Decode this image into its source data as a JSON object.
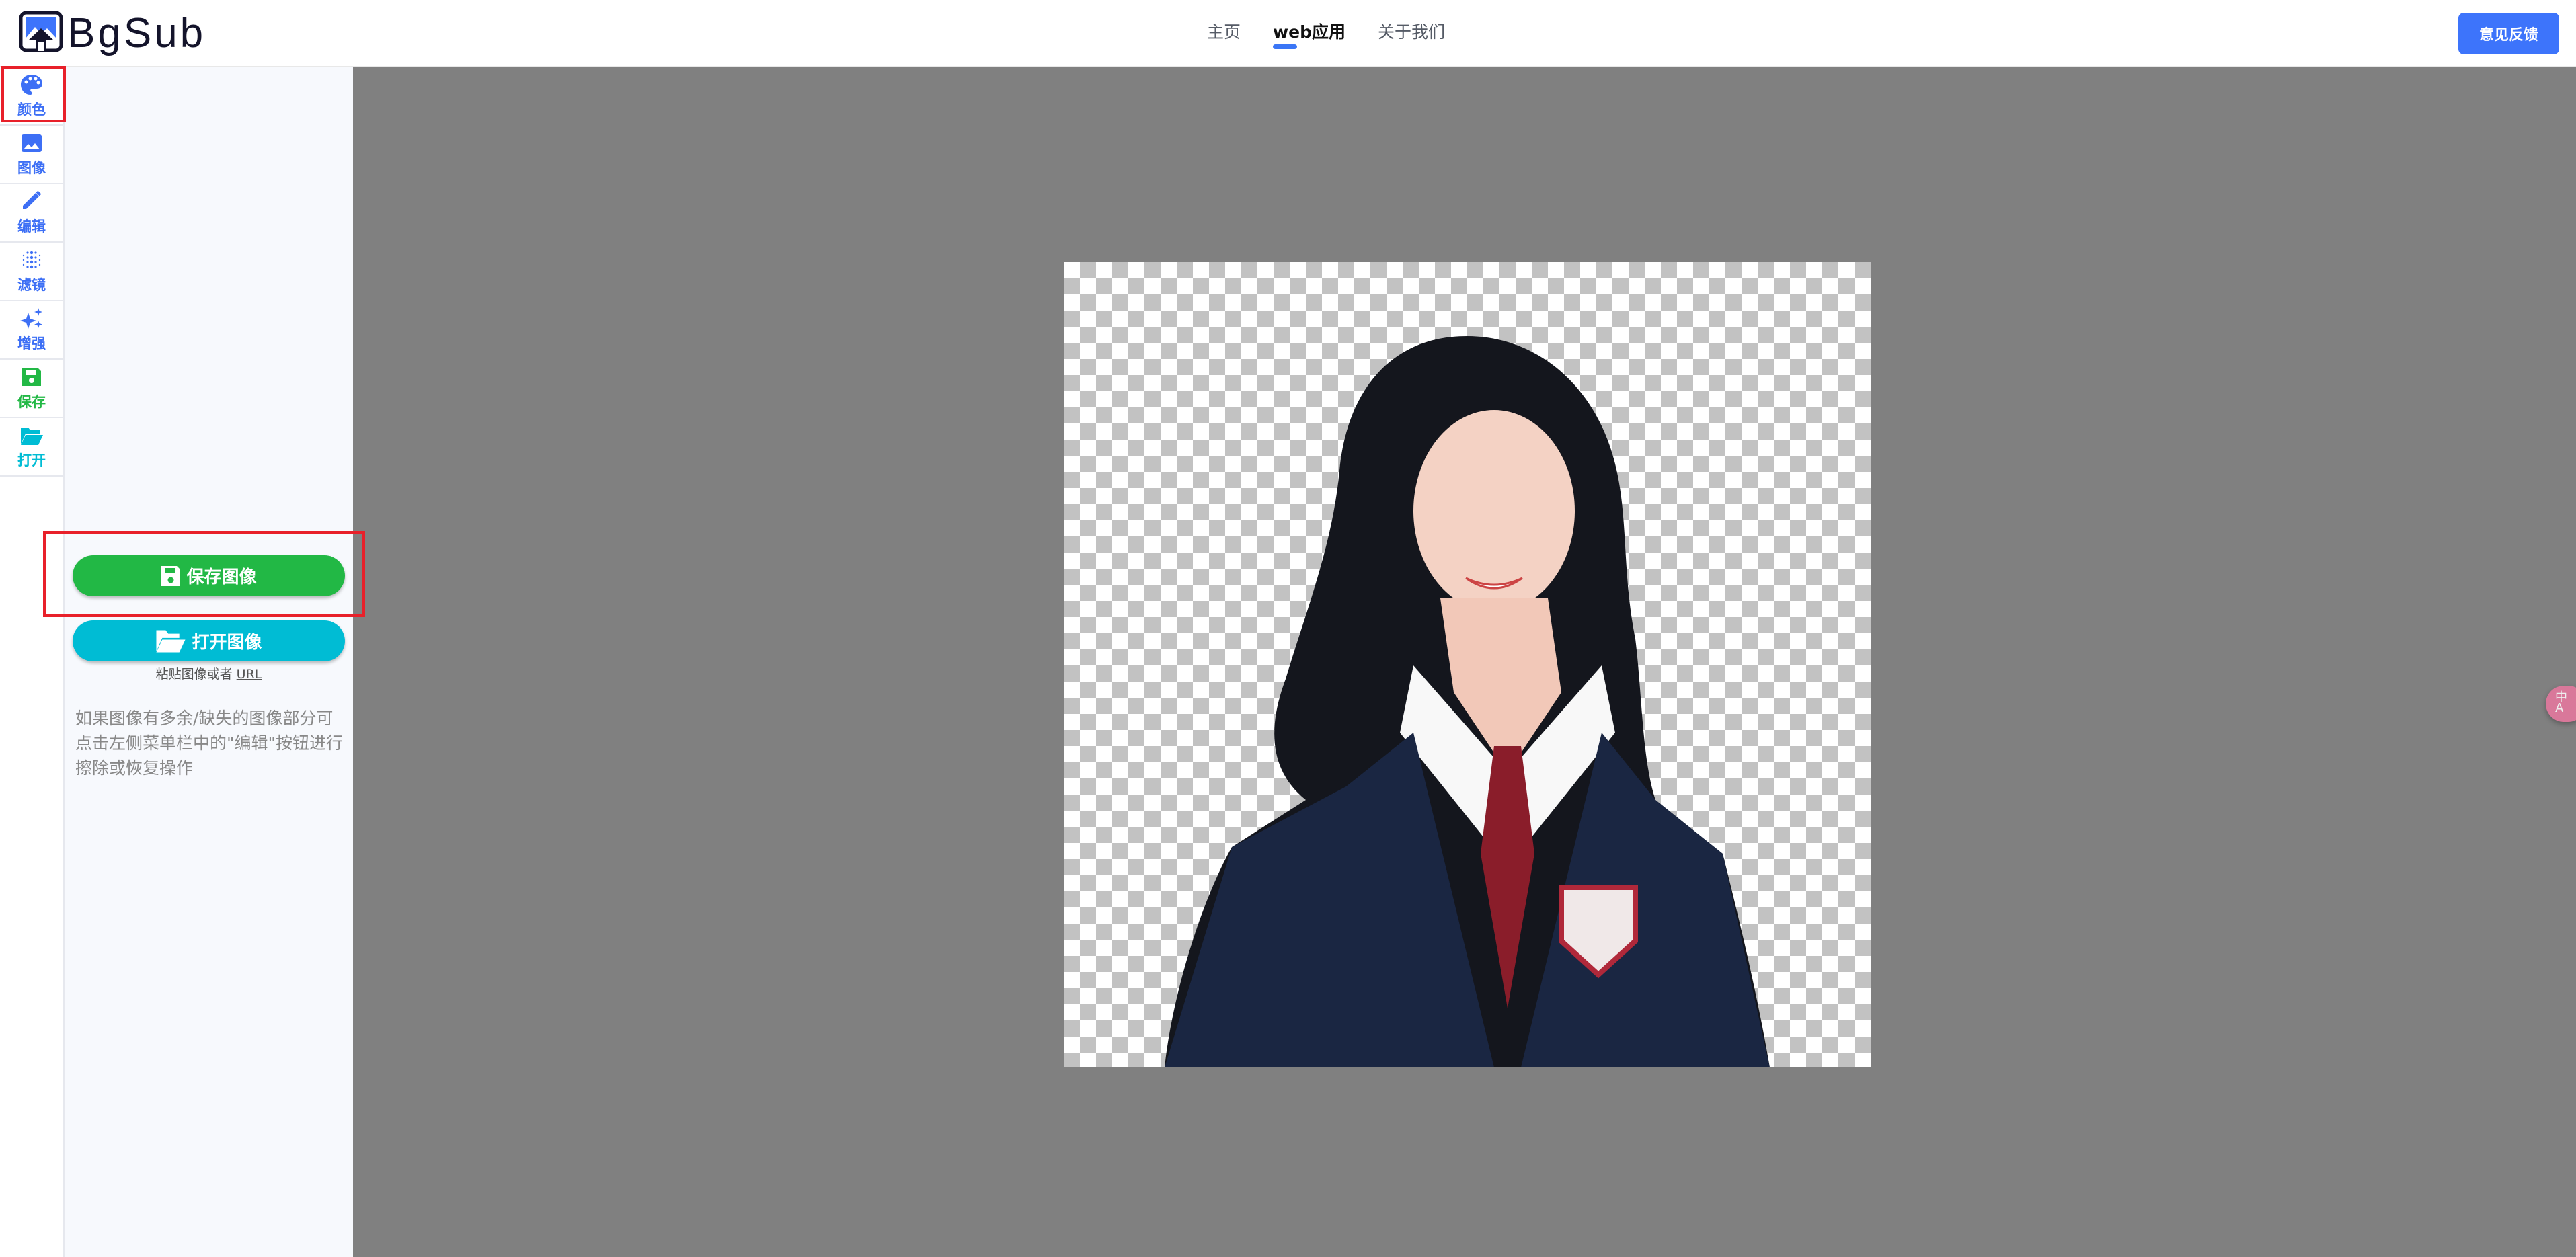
{
  "header": {
    "logo_text": "BgSub",
    "nav": [
      {
        "label": "主页",
        "active": false
      },
      {
        "label": "web应用",
        "active": true
      },
      {
        "label": "关于我们",
        "active": false
      }
    ],
    "feedback_label": "意见反馈"
  },
  "rail": {
    "items": [
      {
        "label": "颜色",
        "icon": "palette-icon",
        "color": "#3d6ff5"
      },
      {
        "label": "图像",
        "icon": "image-icon",
        "color": "#3d6ff5"
      },
      {
        "label": "编辑",
        "icon": "pencil-icon",
        "color": "#3d6ff5"
      },
      {
        "label": "滤镜",
        "icon": "filter-dots-icon",
        "color": "#3d6ff5"
      },
      {
        "label": "增强",
        "icon": "sparkles-icon",
        "color": "#3d6ff5"
      },
      {
        "label": "保存",
        "icon": "floppy-disk-icon",
        "color": "#22b845"
      },
      {
        "label": "打开",
        "icon": "folder-open-icon",
        "color": "#00bcd4"
      }
    ]
  },
  "panel": {
    "save_label": "保存图像",
    "open_label": "打开图像",
    "paste_text": "粘贴图像或者",
    "paste_link": "URL",
    "help_text": "如果图像有多余/缺失的图像部分可点击左侧菜单栏中的\"编辑\"按钮进行擦除或恢复操作"
  },
  "translate_icon": "translate-icon",
  "colors": {
    "accent": "#3d74fb",
    "save": "#22b845",
    "open": "#00bcd4",
    "canvas": "#808080",
    "highlight": "#e8202a"
  }
}
